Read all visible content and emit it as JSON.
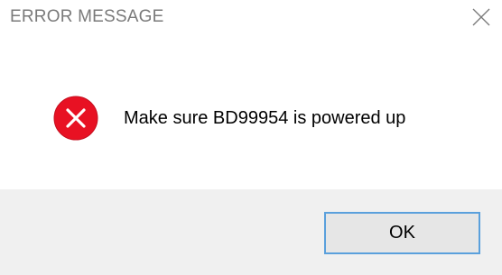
{
  "window": {
    "title": "ERROR MESSAGE",
    "close_icon": "close-icon"
  },
  "content": {
    "icon": "error-icon",
    "message": "Make sure BD99954 is powered up"
  },
  "buttons": {
    "ok_label": "OK"
  },
  "colors": {
    "error_red": "#e81123",
    "button_border": "#5aa0dc",
    "footer_bg": "#f0f0f0",
    "title_text": "#7a7a7a"
  }
}
